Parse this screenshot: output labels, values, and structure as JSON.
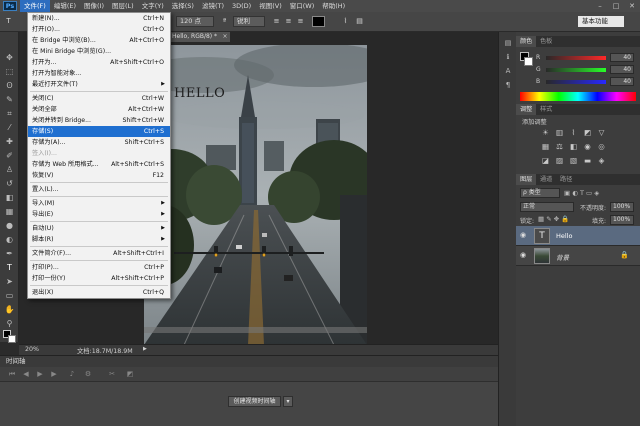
{
  "menubar": {
    "logo": "Ps",
    "items": [
      "文件(F)",
      "编辑(E)",
      "图像(I)",
      "图层(L)",
      "文字(Y)",
      "选择(S)",
      "滤镜(T)",
      "3D(D)",
      "视图(V)",
      "窗口(W)",
      "帮助(H)"
    ]
  },
  "optbar": {
    "font_size": "120 点",
    "aa_mode": "锐利",
    "workspace": "基本功能"
  },
  "doc": {
    "tab_title": "Hello, RGB/8) *",
    "canvas_text": "HELLO",
    "zoom": "20%",
    "doc_info": "文档:18.7M/18.9M"
  },
  "file_menu": {
    "items": [
      {
        "label": "新建(N)...",
        "shortcut": "Ctrl+N"
      },
      {
        "label": "打开(O)...",
        "shortcut": "Ctrl+O"
      },
      {
        "label": "在 Bridge 中浏览(B)...",
        "shortcut": "Alt+Ctrl+O"
      },
      {
        "label": "在 Mini Bridge 中浏览(G)...",
        "shortcut": ""
      },
      {
        "label": "打开为...",
        "shortcut": "Alt+Shift+Ctrl+O"
      },
      {
        "label": "打开为智能对象...",
        "shortcut": ""
      },
      {
        "label": "最近打开文件(T)",
        "shortcut": ""
      },
      {
        "label": "关闭(C)",
        "shortcut": "Ctrl+W"
      },
      {
        "label": "关闭全部",
        "shortcut": "Alt+Ctrl+W"
      },
      {
        "label": "关闭并转到 Bridge...",
        "shortcut": "Shift+Ctrl+W"
      },
      {
        "label": "存储(S)",
        "shortcut": "Ctrl+S"
      },
      {
        "label": "存储为(A)...",
        "shortcut": "Shift+Ctrl+S"
      },
      {
        "label": "签入(I)...",
        "shortcut": ""
      },
      {
        "label": "存储为 Web 所用格式...",
        "shortcut": "Alt+Shift+Ctrl+S"
      },
      {
        "label": "恢复(V)",
        "shortcut": "F12"
      },
      {
        "label": "置入(L)...",
        "shortcut": ""
      },
      {
        "label": "导入(M)",
        "shortcut": ""
      },
      {
        "label": "导出(E)",
        "shortcut": ""
      },
      {
        "label": "自动(U)",
        "shortcut": ""
      },
      {
        "label": "脚本(R)",
        "shortcut": ""
      },
      {
        "label": "文件简介(F)...",
        "shortcut": "Alt+Shift+Ctrl+I"
      },
      {
        "label": "打印(P)...",
        "shortcut": "Ctrl+P"
      },
      {
        "label": "打印一份(Y)",
        "shortcut": "Alt+Shift+Ctrl+P"
      },
      {
        "label": "退出(X)",
        "shortcut": "Ctrl+Q"
      }
    ]
  },
  "panels": {
    "color_tabs": [
      "颜色",
      "色板"
    ],
    "color_values": {
      "R": "40",
      "G": "40",
      "B": "40"
    },
    "adjust_tabs": [
      "调整",
      "样式"
    ],
    "adjust_title": "添加调整",
    "layers_tabs": [
      "图层",
      "通道",
      "路径"
    ],
    "kind_filter": "ρ 类型",
    "blend_mode": "正常",
    "opacity_label": "不透明度:",
    "opacity": "100%",
    "lock_label": "锁定:",
    "fill_label": "填充:",
    "fill": "100%",
    "layers": [
      {
        "name": "Hello",
        "type": "text"
      },
      {
        "name": "背景",
        "type": "image"
      }
    ]
  },
  "timeline": {
    "title": "时间轴",
    "create_button": "创建视频时间轴"
  },
  "colors": {
    "accent": "#1f6fd0",
    "menubar": "#4a4a4a",
    "panel": "#3d3d3d",
    "workspace": "#282828"
  }
}
